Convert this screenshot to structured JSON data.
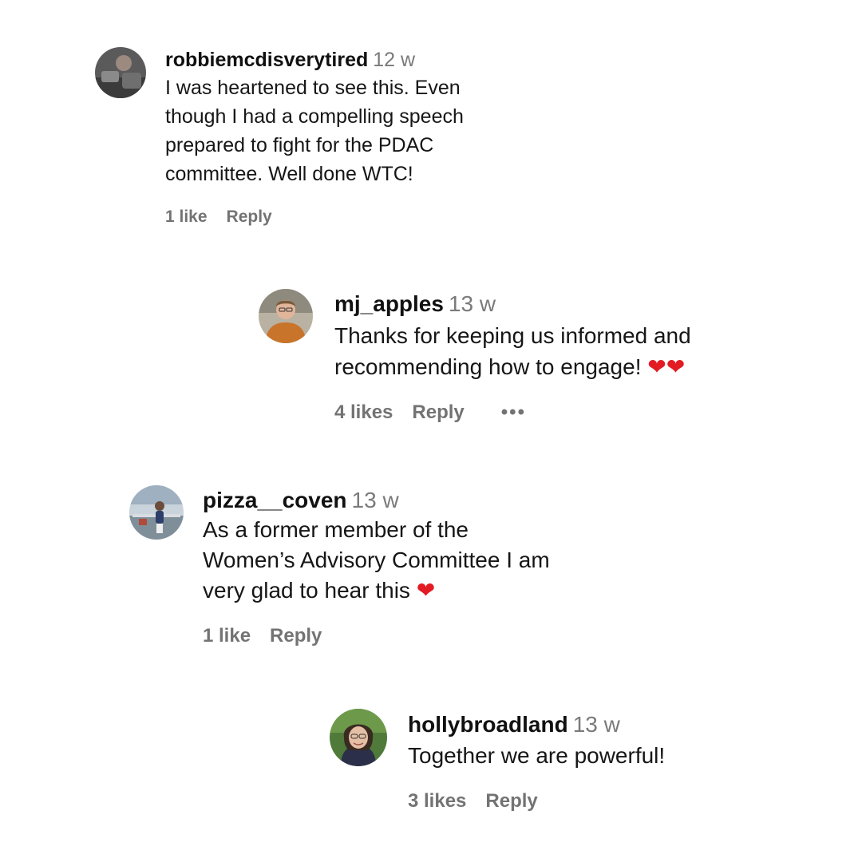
{
  "comments": [
    {
      "username": "robbiemcdisverytired",
      "time": "12 w",
      "text": "I was heartened to see this. Even\nthough I had a compelling speech\nprepared to fight for the PDAC\ncommittee. Well done WTC!",
      "likes": "1 like",
      "reply": "Reply"
    },
    {
      "username": "mj_apples",
      "time": "13 w",
      "text": "Thanks for keeping us informed and\nrecommending how to engage!",
      "emoji": "❤❤",
      "likes": "4 likes",
      "reply": "Reply",
      "more": "•••"
    },
    {
      "username": "pizza__coven",
      "time": "13 w",
      "text": "As a former member of the\nWomen’s Advisory Committee I am\nvery glad to hear this",
      "emoji": "❤",
      "likes": "1 like",
      "reply": "Reply"
    },
    {
      "username": "hollybroadland",
      "time": "13 w",
      "text": "Together we are powerful!",
      "likes": "3 likes",
      "reply": "Reply"
    }
  ],
  "colors": {
    "username": "#111111",
    "timestamp": "#7a7a7a",
    "actions": "#737373",
    "heart": "#e31b23"
  }
}
